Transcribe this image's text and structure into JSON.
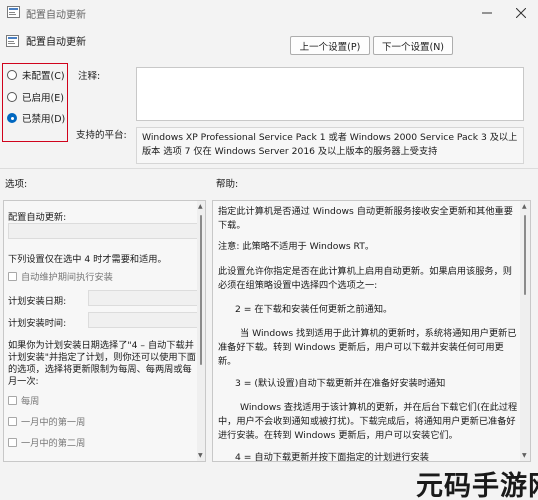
{
  "window": {
    "title": "配置自动更新"
  },
  "header": {
    "setting_name": "配置自动更新",
    "prev_button": "上一个设置(P)",
    "next_button": "下一个设置(N)"
  },
  "state_options": [
    {
      "label": "未配置(C)",
      "selected": false
    },
    {
      "label": "已启用(E)",
      "selected": false
    },
    {
      "label": "已禁用(D)",
      "selected": true
    }
  ],
  "labels": {
    "comment": "注释:",
    "supported_on": "支持的平台:",
    "options": "选项:",
    "help": "帮助:"
  },
  "supported_on_text": "Windows XP Professional Service Pack 1 或者 Windows 2000 Service Pack 3 及以上版本 选项 7 仅在 Windows Server 2016 及以上版本的服务器上受支持",
  "options": {
    "heading": "配置自动更新:",
    "schedule_note": "下列设置仅在选中 4 时才需要和适用。",
    "maintenance_checkbox": "自动维护期间执行安装",
    "install_day_label": "计划安装日期:",
    "install_time_label": "计划安装时间:",
    "weekly_note_1": "如果你为计划安装日期选择了\"4 – 自动下载并",
    "weekly_note_2": "计划安装\"并指定了计划，则你还可以使用下面",
    "weekly_note_3": "的选项，选择将更新限制为每周、每两周或每",
    "weekly_note_4": "月一次:",
    "weekly_checkbox": "每周",
    "first_week_checkbox": "一月中的第一周",
    "second_week_checkbox": "一月中的第二周"
  },
  "help": {
    "p1": "指定此计算机是否通过 Windows 自动更新服务接收安全更新和其他重要下载。",
    "p2": "注意: 此策略不适用于 Windows RT。",
    "p3": "此设置允许你指定是否在此计算机上启用自动更新。如果启用该服务，则必须在组策略设置中选择四个选项之一:",
    "p4": "2 = 在下载和安装任何更新之前通知。",
    "p5": "当 Windows 找到适用于此计算机的更新时，系统将通知用户更新已准备好下载。转到 Windows 更新后，用户可以下载并安装任何可用更新。",
    "p6": "3 = (默认设置)自动下载更新并在准备好安装时通知",
    "p7": "Windows 查找适用于该计算机的更新，并在后台下载它们(在此过程中，用户不会收到通知或被打扰)。下载完成后，将通知用户更新已准备好进行安装。在转到 Windows 更新后，用户可以安装它们。",
    "p8": "4 = 自动下载更新并按下面指定的计划进行安装"
  },
  "watermark": {
    "text": "元码手游网"
  },
  "colors": {
    "highlight_border": "#d0021b",
    "radio_selected": "#0067c0"
  }
}
